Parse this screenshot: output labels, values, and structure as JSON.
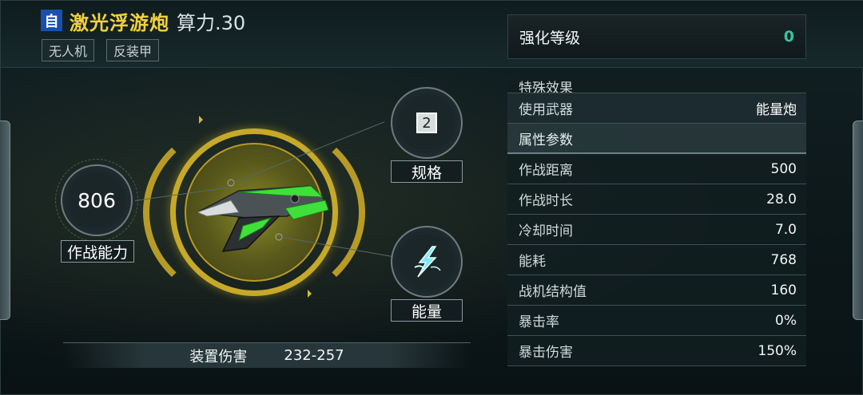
{
  "header": {
    "auto_tag": "自",
    "weapon_name": "激光浮游炮",
    "power_label": "算力.30",
    "chips": [
      "无人机",
      "反装甲"
    ]
  },
  "enhance": {
    "label": "强化等级",
    "value": "0"
  },
  "stats": {
    "cut_label": "特殊效果",
    "weapon_label": "使用武器",
    "weapon_value": "能量炮",
    "section_title": "属性参数",
    "rows": [
      {
        "label": "作战距离",
        "value": "500"
      },
      {
        "label": "作战时长",
        "value": "28.0"
      },
      {
        "label": "冷却时间",
        "value": "7.0"
      },
      {
        "label": "能耗",
        "value": "768"
      },
      {
        "label": "战机结构值",
        "value": "160"
      },
      {
        "label": "暴击率",
        "value": "0%"
      },
      {
        "label": "暴击伤害",
        "value": "150%"
      }
    ]
  },
  "combat": {
    "power_value": "806",
    "power_label": "作战能力"
  },
  "spec": {
    "value": "2",
    "label": "规格"
  },
  "energy": {
    "label": "能量",
    "icon": "energy-lightning-icon"
  },
  "damage": {
    "label": "装置伤害",
    "value": "232-257"
  },
  "colors": {
    "gold": "#c7a92a",
    "accent_green": "#34c7a5",
    "name_yellow": "#f2d23c",
    "tag_blue": "#1a4fb0"
  }
}
